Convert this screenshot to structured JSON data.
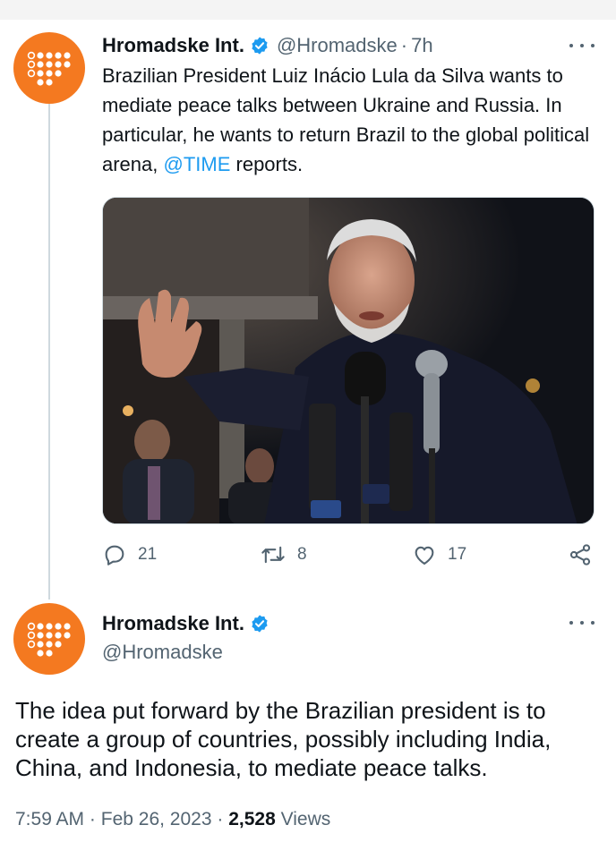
{
  "colors": {
    "accent": "#1d9bf0",
    "avatar_bg": "#f47920",
    "muted": "#536471"
  },
  "tweet1": {
    "author": {
      "display_name": "Hromadske Int.",
      "handle": "@Hromadske",
      "verified": true
    },
    "separator": "·",
    "time": "7h",
    "text_before_mention": "Brazilian President Luiz Inácio Lula da Silva wants to mediate peace talks between Ukraine and Russia. In particular, he wants to return Brazil to the global political arena, ",
    "mention": "@TIME",
    "text_after_mention": " reports.",
    "actions": {
      "replies": "21",
      "retweets": "8",
      "likes": "17"
    }
  },
  "tweet2": {
    "author": {
      "display_name": "Hromadske Int.",
      "handle": "@Hromadske",
      "verified": true
    },
    "text": "The idea put forward by the Brazilian president is to create a group of countries, possibly including India, China, and Indonesia, to mediate peace talks.",
    "time": "7:59 AM",
    "separator1": "·",
    "date": "Feb 26, 2023",
    "separator2": "·",
    "views_count": "2,528",
    "views_label": "Views"
  },
  "icons": [
    "verified-badge-icon",
    "more-options-icon",
    "reply-icon",
    "retweet-icon",
    "like-icon",
    "share-icon"
  ]
}
